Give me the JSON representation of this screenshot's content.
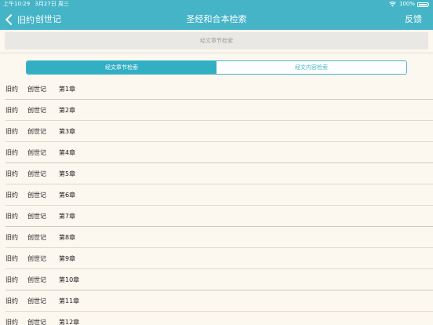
{
  "status_bar": {
    "time": "上午10:29",
    "date": "3月27日 周三",
    "battery": "100%"
  },
  "nav": {
    "back_label": "旧约",
    "book": "创世记",
    "title": "圣经和合本检索",
    "feedback": "反馈"
  },
  "search": {
    "placeholder": "经文章节检索"
  },
  "segments": {
    "active": "经文章节检索",
    "inactive": "经文内容检索"
  },
  "colors": {
    "accent": "#45b4c7",
    "background": "#fcf7ef"
  },
  "icons": {
    "back": "chevron-left-icon",
    "wifi": "wifi-icon",
    "battery": "battery-icon"
  },
  "chapters": [
    {
      "testament": "旧约",
      "book": "创世记",
      "chapter": "第1章"
    },
    {
      "testament": "旧约",
      "book": "创世记",
      "chapter": "第2章"
    },
    {
      "testament": "旧约",
      "book": "创世记",
      "chapter": "第3章"
    },
    {
      "testament": "旧约",
      "book": "创世记",
      "chapter": "第4章"
    },
    {
      "testament": "旧约",
      "book": "创世记",
      "chapter": "第5章"
    },
    {
      "testament": "旧约",
      "book": "创世记",
      "chapter": "第6章"
    },
    {
      "testament": "旧约",
      "book": "创世记",
      "chapter": "第7章"
    },
    {
      "testament": "旧约",
      "book": "创世记",
      "chapter": "第8章"
    },
    {
      "testament": "旧约",
      "book": "创世记",
      "chapter": "第9章"
    },
    {
      "testament": "旧约",
      "book": "创世记",
      "chapter": "第10章"
    },
    {
      "testament": "旧约",
      "book": "创世记",
      "chapter": "第11章"
    },
    {
      "testament": "旧约",
      "book": "创世记",
      "chapter": "第12章"
    }
  ]
}
